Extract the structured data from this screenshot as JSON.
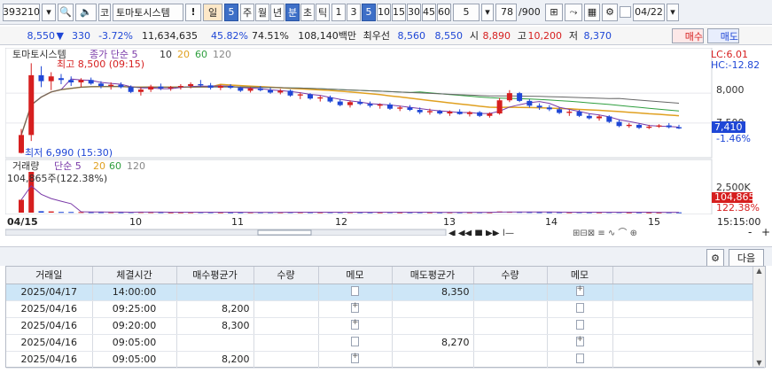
{
  "toolbar": {
    "code": "393210",
    "mode_label": "코",
    "stock_name": "토마토시스템",
    "alert_label": "!",
    "period_day": "일",
    "period_n": "5",
    "periods": [
      "주",
      "월",
      "년",
      "분",
      "초",
      "틱"
    ],
    "minute_choices": [
      "1",
      "3",
      "5",
      "10",
      "15",
      "30",
      "45",
      "60"
    ],
    "minute_selected": "5",
    "minute_value": "5",
    "view_count": "78",
    "view_total": "/900",
    "date": "04/22"
  },
  "quote": {
    "price": "8,550",
    "change": "330",
    "change_pct": "-3.72%",
    "volume": "11,634,635",
    "vol_ratio": "45.82%",
    "rate2": "74.51%",
    "amount": "108,140백만",
    "best_ask_label": "최우선",
    "best_ask": "8,560",
    "best_bid": "8,550",
    "open_label": "시",
    "open": "8,890",
    "high_label": "고",
    "high": "10,200",
    "low_label": "저",
    "low": "8,370",
    "buy_label": "매수",
    "sell_label": "매도"
  },
  "chart_data": {
    "type": "candlestick",
    "price_panel": {
      "legend": [
        "토마토시스템",
        "종가 단순 5",
        "10",
        "20",
        "60",
        "120"
      ],
      "y_ticks": [
        "8,000",
        "7,500"
      ],
      "current_price": "7,410",
      "current_pct": "-1.46%",
      "lc": "LC:6.01",
      "hc": "HC:-12.82",
      "max_label": "최고 8,500 (09:15)",
      "min_label": "최저 6,990 (15:30)",
      "ohlc": [
        [
          7000,
          7400,
          6990,
          7300
        ],
        [
          7300,
          8500,
          7200,
          8300
        ],
        [
          8300,
          8450,
          8100,
          8200
        ],
        [
          8200,
          8350,
          8050,
          8280
        ],
        [
          8250,
          8320,
          8150,
          8220
        ],
        [
          8220,
          8280,
          8120,
          8180
        ],
        [
          8180,
          8250,
          8100,
          8220
        ],
        [
          8220,
          8260,
          8140,
          8160
        ],
        [
          8160,
          8200,
          8080,
          8120
        ],
        [
          8120,
          8180,
          8060,
          8140
        ],
        [
          8140,
          8180,
          8080,
          8100
        ],
        [
          8100,
          8130,
          8000,
          8020
        ],
        [
          8020,
          8100,
          7960,
          8060
        ],
        [
          8060,
          8140,
          8020,
          8110
        ],
        [
          8110,
          8160,
          8050,
          8080
        ],
        [
          8080,
          8120,
          8040,
          8100
        ],
        [
          8100,
          8150,
          8060,
          8120
        ],
        [
          8120,
          8180,
          8080,
          8150
        ],
        [
          8150,
          8220,
          8100,
          8130
        ],
        [
          8130,
          8170,
          8060,
          8090
        ],
        [
          8090,
          8140,
          8050,
          8120
        ],
        [
          8120,
          8150,
          8070,
          8090
        ],
        [
          8090,
          8110,
          8020,
          8040
        ],
        [
          8040,
          8100,
          8010,
          8080
        ],
        [
          8080,
          8120,
          8030,
          8050
        ],
        [
          8050,
          8090,
          7990,
          8010
        ],
        [
          8010,
          8070,
          7980,
          8040
        ],
        [
          8040,
          8060,
          7940,
          7960
        ],
        [
          7960,
          8010,
          7900,
          7980
        ],
        [
          7980,
          8000,
          7890,
          7910
        ],
        [
          7910,
          7960,
          7860,
          7930
        ],
        [
          7930,
          7960,
          7840,
          7860
        ],
        [
          7860,
          7900,
          7780,
          7800
        ],
        [
          7800,
          7880,
          7760,
          7850
        ],
        [
          7850,
          7900,
          7800,
          7820
        ],
        [
          7820,
          7860,
          7760,
          7790
        ],
        [
          7790,
          7830,
          7740,
          7810
        ],
        [
          7810,
          7840,
          7720,
          7740
        ],
        [
          7740,
          7790,
          7700,
          7760
        ],
        [
          7760,
          7800,
          7700,
          7720
        ],
        [
          7720,
          7760,
          7650,
          7680
        ],
        [
          7680,
          7740,
          7640,
          7700
        ],
        [
          7700,
          7720,
          7640,
          7660
        ],
        [
          7660,
          7710,
          7620,
          7690
        ],
        [
          7690,
          7730,
          7640,
          7650
        ],
        [
          7650,
          7700,
          7610,
          7680
        ],
        [
          7680,
          7700,
          7600,
          7620
        ],
        [
          7620,
          7680,
          7590,
          7660
        ],
        [
          7660,
          7920,
          7640,
          7880
        ],
        [
          7880,
          8050,
          7850,
          8000
        ],
        [
          8000,
          8020,
          7850,
          7870
        ],
        [
          7870,
          7900,
          7760,
          7790
        ],
        [
          7790,
          7830,
          7720,
          7760
        ],
        [
          7760,
          7800,
          7700,
          7730
        ],
        [
          7730,
          7760,
          7650,
          7670
        ],
        [
          7670,
          7720,
          7620,
          7690
        ],
        [
          7690,
          7720,
          7600,
          7620
        ],
        [
          7620,
          7660,
          7560,
          7580
        ],
        [
          7580,
          7640,
          7540,
          7610
        ],
        [
          7610,
          7630,
          7500,
          7520
        ],
        [
          7520,
          7560,
          7430,
          7450
        ],
        [
          7450,
          7500,
          7420,
          7470
        ],
        [
          7470,
          7490,
          7400,
          7420
        ],
        [
          7420,
          7470,
          7400,
          7440
        ],
        [
          7440,
          7480,
          7420,
          7460
        ],
        [
          7460,
          7500,
          7410,
          7430
        ],
        [
          7430,
          7470,
          7400,
          7410
        ]
      ]
    },
    "volume_panel": {
      "legend": [
        "거래량",
        "단순 5",
        "20",
        "60",
        "120"
      ],
      "volume_label": "104,865주(122.38%)",
      "y_tick": "2,500K",
      "current_volume": "104,865",
      "current_pct": "122.38%"
    },
    "x_labels": [
      "04/15",
      "10",
      "11",
      "12",
      "13",
      "14",
      "15"
    ],
    "time_label": "15:15:00"
  },
  "controls": {
    "zoom_out": "-",
    "zoom_in": "+",
    "next_label": "다음"
  },
  "table": {
    "headers": [
      "거래일",
      "체결시간",
      "매수평균가",
      "수량",
      "메모",
      "매도평균가",
      "수량",
      "메모"
    ],
    "rows": [
      {
        "date": "2025/04/17",
        "time": "14:00:00",
        "buy_avg": "",
        "buy_qty": "",
        "sell_avg": "8,350",
        "sell_qty": ""
      },
      {
        "date": "2025/04/16",
        "time": "09:25:00",
        "buy_avg": "8,200",
        "buy_qty": "",
        "sell_avg": "",
        "sell_qty": ""
      },
      {
        "date": "2025/04/16",
        "time": "09:20:00",
        "buy_avg": "8,300",
        "buy_qty": "",
        "sell_avg": "",
        "sell_qty": ""
      },
      {
        "date": "2025/04/16",
        "time": "09:05:00",
        "buy_avg": "",
        "buy_qty": "",
        "sell_avg": "8,270",
        "sell_qty": ""
      },
      {
        "date": "2025/04/16",
        "time": "09:05:00",
        "buy_avg": "8,200",
        "buy_qty": "",
        "sell_avg": "",
        "sell_qty": ""
      }
    ]
  },
  "colors": {
    "up": "#d61f1f",
    "down": "#1f47d6",
    "selected_row": "#cde6f7",
    "accent": "#3d6fc7"
  }
}
